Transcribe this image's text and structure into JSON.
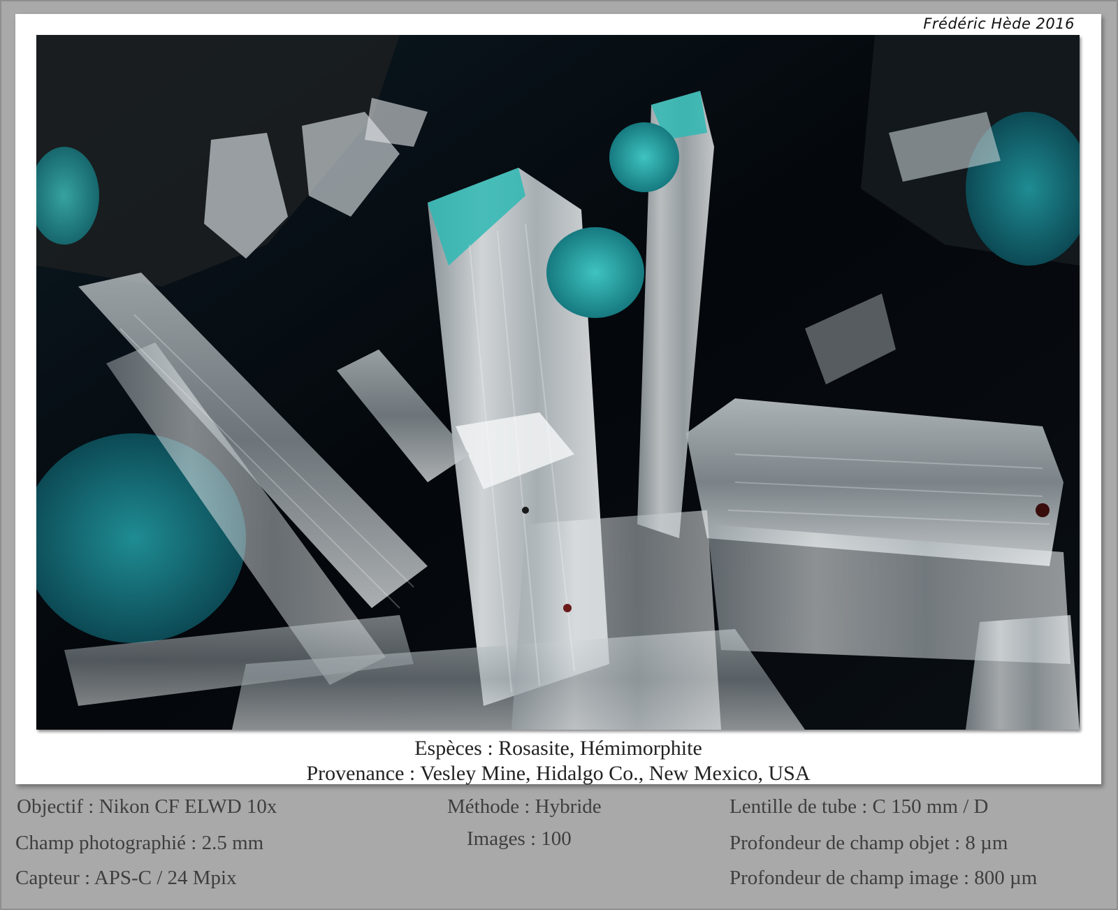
{
  "credit": "Frédéric Hède 2016",
  "caption": {
    "species": "Espèces : Rosasite, Hémimorphite",
    "origin": "Provenance : Vesley Mine, Hidalgo Co., New Mexico, USA"
  },
  "specs": {
    "objective": "Objectif : Nikon CF ELWD 10x",
    "field": "Champ photographié : 2.5 mm",
    "sensor": "Capteur : APS-C / 24 Mpix",
    "method": "Méthode : Hybride",
    "images": "Images : 100",
    "tube_lens": "Lentille de tube : C 150 mm / D",
    "object_dof": "Profondeur de champ objet : 8 µm",
    "image_dof": "Profondeur de champ image : 800 µm"
  },
  "colors": {
    "background": "#a9a9a9",
    "rosasite": "#2aa6a6",
    "crystal": "#d8dde0"
  }
}
